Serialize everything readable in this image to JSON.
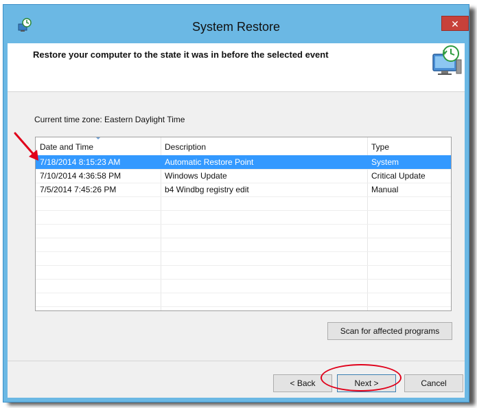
{
  "window": {
    "title": "System Restore",
    "close_label": "✕"
  },
  "header": {
    "instruction": "Restore your computer to the state it was in before the selected event"
  },
  "timezone": "Current time zone: Eastern Daylight Time",
  "table": {
    "columns": [
      "Date and Time",
      "Description",
      "Type"
    ],
    "rows": [
      {
        "date": "7/18/2014 8:15:23 AM",
        "description": "Automatic Restore Point",
        "type": "System",
        "selected": true
      },
      {
        "date": "7/10/2014 4:36:58 PM",
        "description": "Windows Update",
        "type": "Critical Update",
        "selected": false
      },
      {
        "date": "7/5/2014 7:45:26 PM",
        "description": "b4 Windbg registry edit",
        "type": "Manual",
        "selected": false
      }
    ]
  },
  "buttons": {
    "scan": "Scan for affected programs",
    "back": "< Back",
    "next": "Next >",
    "cancel": "Cancel"
  },
  "colors": {
    "selection": "#3399ff",
    "titlebar": "#6bb8e4",
    "close": "#c7413a",
    "annotation": "#e0001a"
  }
}
